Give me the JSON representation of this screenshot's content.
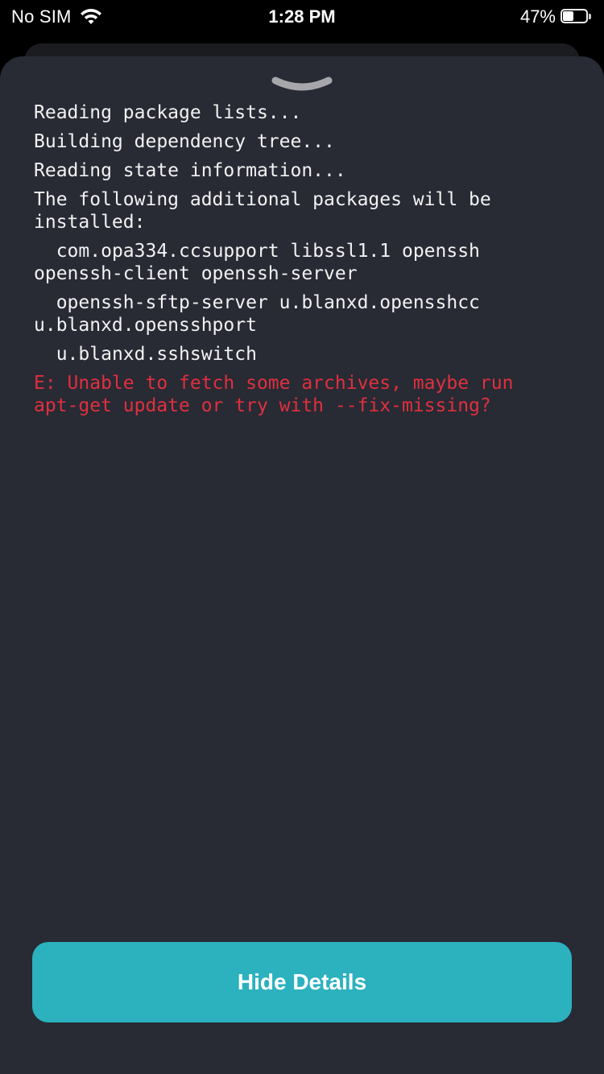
{
  "status_bar": {
    "carrier": "No SIM",
    "time": "1:28 PM",
    "battery_percent": "47%",
    "battery_level": 0.47,
    "icons": [
      "wifi-icon",
      "battery-icon"
    ]
  },
  "sheet": {
    "grabber_icon": "chevron-down-icon",
    "background_color": "#282a34",
    "console_lines": [
      {
        "text": "Reading package lists...",
        "type": "normal"
      },
      {
        "text": "Building dependency tree...",
        "type": "normal"
      },
      {
        "text": "Reading state information...",
        "type": "normal"
      },
      {
        "text": "The following additional packages will be installed:",
        "type": "normal"
      },
      {
        "text": "  com.opa334.ccsupport libssl1.1 openssh openssh-client openssh-server",
        "type": "normal"
      },
      {
        "text": "  openssh-sftp-server u.blanxd.opensshcc u.blanxd.opensshport",
        "type": "normal"
      },
      {
        "text": "  u.blanxd.sshswitch",
        "type": "normal"
      },
      {
        "text": "E: Unable to fetch some archives, maybe run apt-get update or try with --fix-missing?",
        "type": "error"
      }
    ],
    "error_color": "#e0303e"
  },
  "hide_details_button": {
    "label": "Hide Details",
    "color": "#2cb1be"
  }
}
